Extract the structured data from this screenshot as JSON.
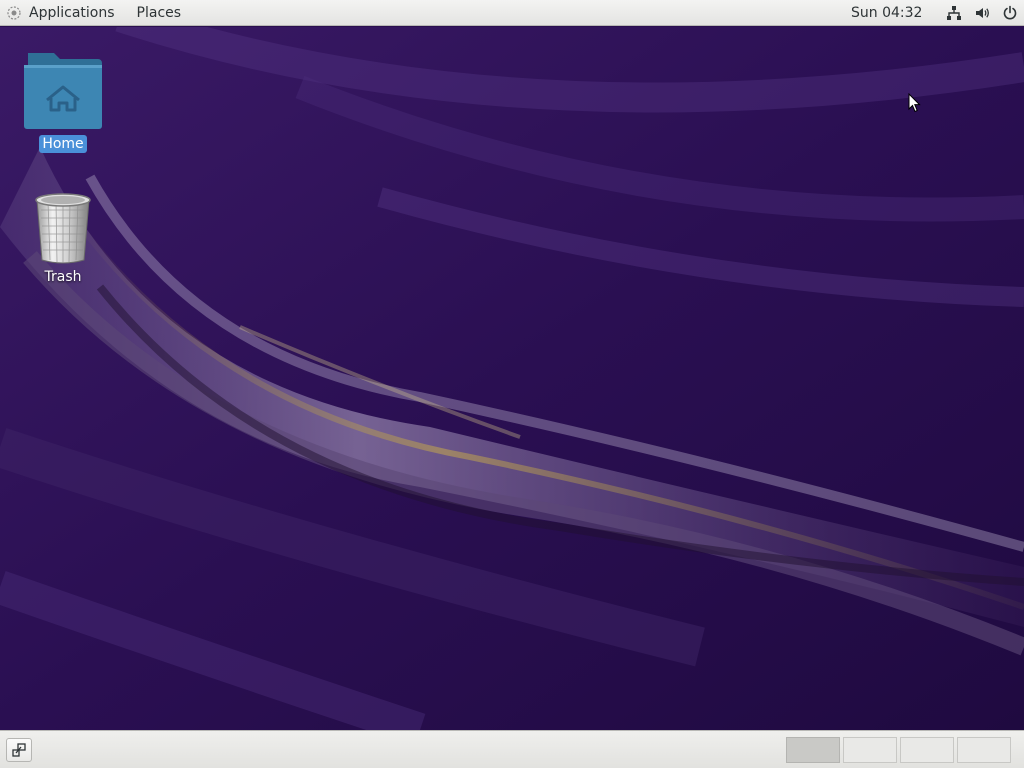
{
  "top_bar": {
    "applications_label": "Applications",
    "places_label": "Places",
    "clock": "Sun 04:32",
    "tray_icons": [
      "network-icon",
      "volume-icon",
      "power-icon"
    ]
  },
  "desktop": {
    "icons": [
      {
        "label": "Home",
        "icon": "home-folder-icon",
        "selected": true
      },
      {
        "label": "Trash",
        "icon": "trash-icon",
        "selected": false
      }
    ]
  },
  "bottom_bar": {
    "show_desktop_icon": "show-desktop-icon",
    "workspaces": 4,
    "active_workspace": 1
  },
  "colors": {
    "wallpaper_base": "#2a0f4f",
    "selection": "#4a90d9",
    "folder": "#3d86b3",
    "panel": "#e8e8e6"
  }
}
